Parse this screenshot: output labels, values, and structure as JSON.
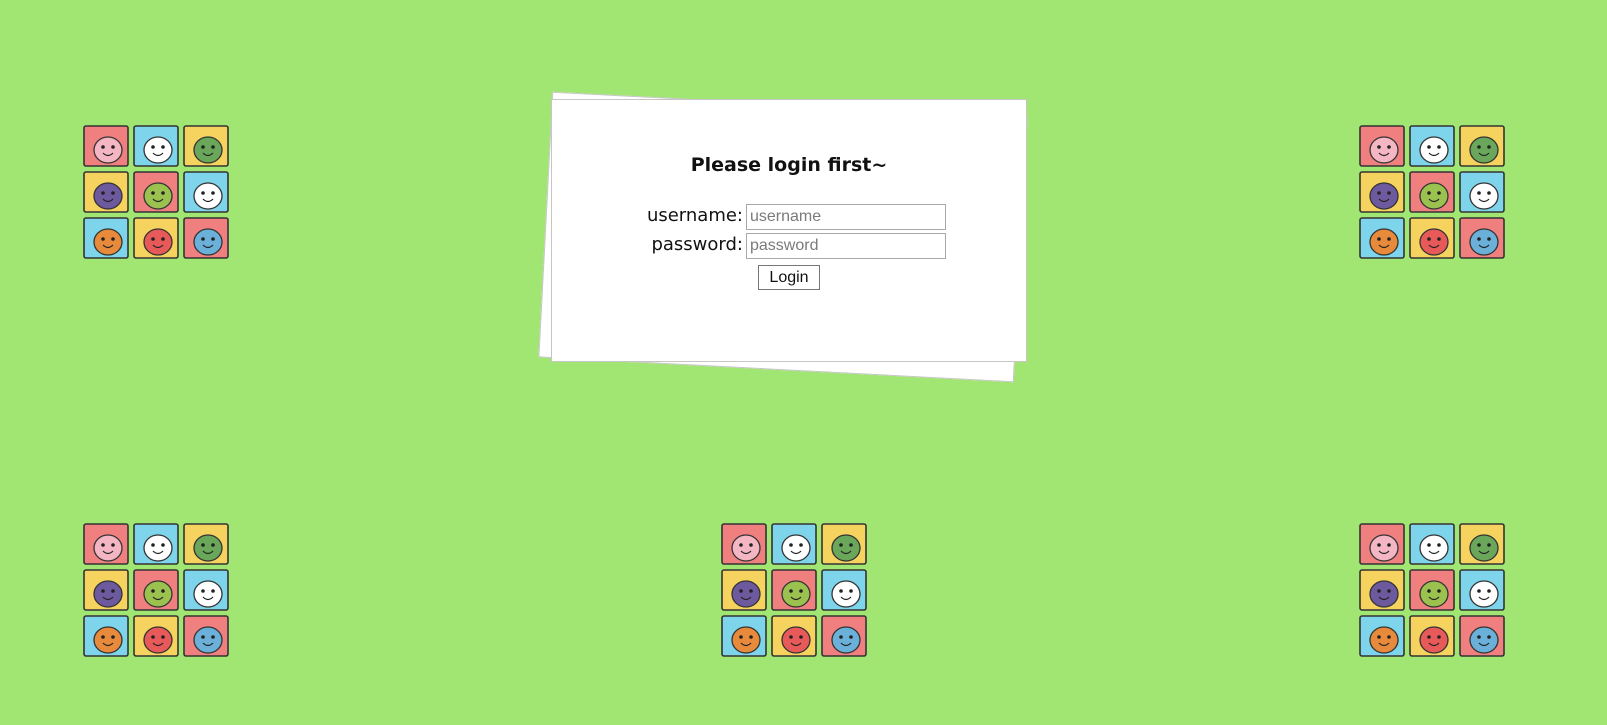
{
  "page": {
    "background_color": "#a1e573"
  },
  "login": {
    "title": "Please login first~",
    "username_label": "username:",
    "username_placeholder": "username",
    "username_value": "",
    "password_label": "password:",
    "password_placeholder": "password",
    "password_value": "",
    "submit_label": "Login"
  },
  "decor": {
    "tile_icon": "cartoon-animal-grid-icon",
    "tile_colors": [
      "#f08080",
      "#7ed4ea",
      "#f6d35e",
      "#f6d35e",
      "#f08080",
      "#7ed4ea",
      "#7ed4ea",
      "#f6d35e",
      "#f08080"
    ]
  }
}
